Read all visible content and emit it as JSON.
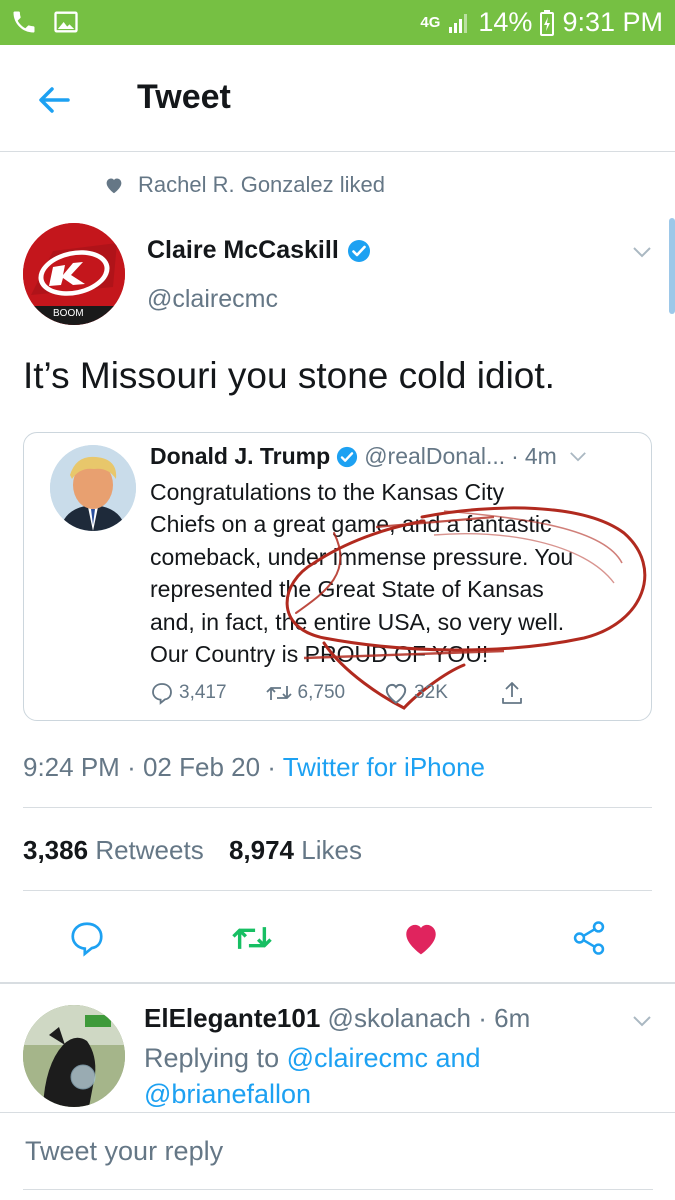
{
  "status": {
    "network": "4G",
    "battery": "14%",
    "time": "9:31 PM"
  },
  "header": {
    "title": "Tweet"
  },
  "social_context": "Rachel R. Gonzalez liked",
  "tweet": {
    "name": "Claire McCaskill",
    "handle": "@clairecmc",
    "avatar_tag": "BOOM",
    "text": "It’s Missouri you stone cold idiot.",
    "time": "9:24 PM",
    "date": "02 Feb 20",
    "source": "Twitter for iPhone",
    "retweets": "3,386",
    "retweets_label": "Retweets",
    "likes": "8,974",
    "likes_label": "Likes"
  },
  "quoted": {
    "name": "Donald J. Trump",
    "handle": "@realDonal...",
    "time": "4m",
    "text": "Congratulations to the Kansas City\nChiefs on a great game, and a fantastic\ncomeback, under immense pressure. You\nrepresented the Great State of Kansas\nand, in fact, the entire USA, so very well.\nOur Country is PROUD OF YOU!",
    "replies": "3,417",
    "retweets": "6,750",
    "likes": "32K"
  },
  "reply": {
    "name": "ElElegante101",
    "handle": "@skolanach",
    "time": "6m",
    "replying_prefix": "Replying to ",
    "mention1": "@clairecmc",
    "and": " and ",
    "mention2": "@brianefallon"
  },
  "composer": {
    "placeholder": "Tweet your reply"
  },
  "colors": {
    "status_bar": "#76c043",
    "twitter_blue": "#1da1f2",
    "like_red": "#e0245e",
    "retweet_green": "#17bf63",
    "annotation_red": "#b12a1f"
  }
}
